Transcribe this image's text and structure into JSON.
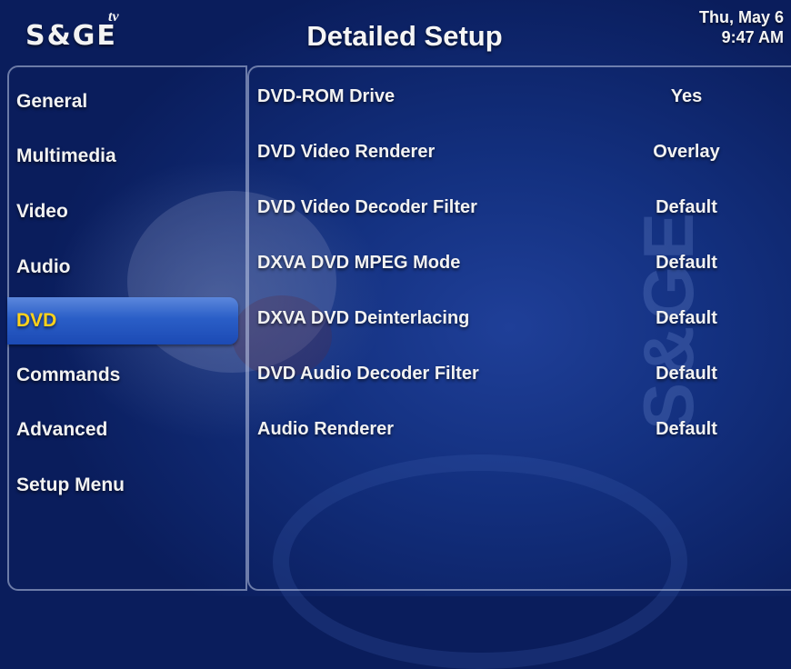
{
  "header": {
    "logo": "S&GE",
    "logo_tv": "tv",
    "title": "Detailed Setup",
    "date": "Thu, May 6",
    "time": "9:47 AM"
  },
  "sidebar": {
    "items": [
      {
        "label": "General"
      },
      {
        "label": "Multimedia"
      },
      {
        "label": "Video"
      },
      {
        "label": "Audio"
      },
      {
        "label": "DVD",
        "selected": true
      },
      {
        "label": "Commands"
      },
      {
        "label": "Advanced"
      },
      {
        "label": "Setup Menu"
      }
    ]
  },
  "settings": {
    "rows": [
      {
        "label": "DVD-ROM Drive",
        "value": "Yes"
      },
      {
        "label": "DVD Video Renderer",
        "value": "Overlay"
      },
      {
        "label": "DVD Video Decoder Filter",
        "value": "Default"
      },
      {
        "label": "DXVA DVD MPEG Mode",
        "value": "Default"
      },
      {
        "label": "DXVA DVD Deinterlacing",
        "value": "Default"
      },
      {
        "label": "DVD Audio Decoder Filter",
        "value": "Default"
      },
      {
        "label": "Audio Renderer",
        "value": "Default"
      }
    ]
  },
  "colors": {
    "background": "#0a1d5c",
    "selected_highlight": "#2a5ec7",
    "selected_text": "#ffd21a"
  }
}
